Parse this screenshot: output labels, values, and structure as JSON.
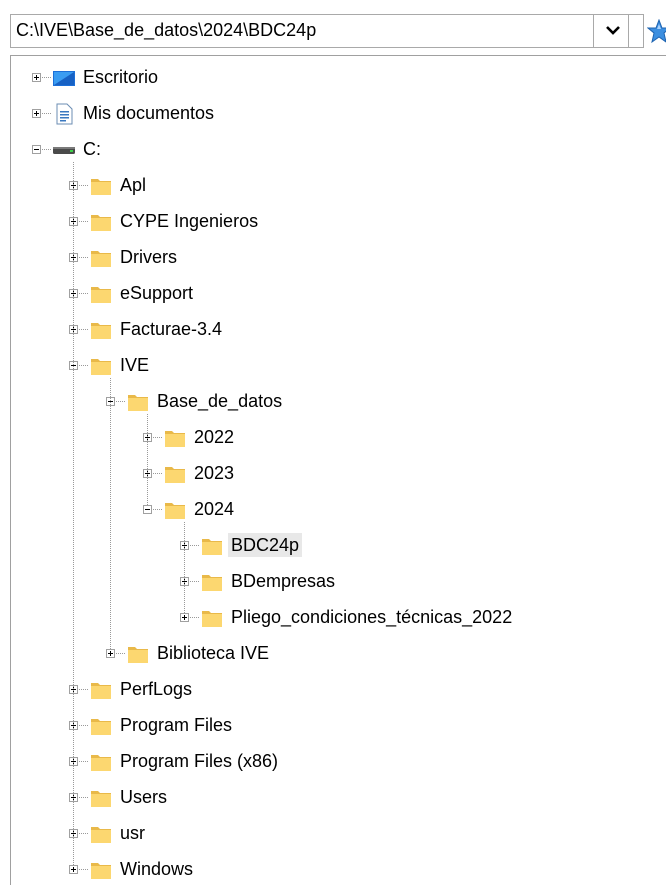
{
  "path": {
    "value": "C:\\IVE\\Base_de_datos\\2024\\BDC24p"
  },
  "icons": {
    "chevron": "chevron-down-icon",
    "favorite": "star-icon",
    "folder": "folder-icon",
    "drive": "drive-icon",
    "desktop": "desktop-icon",
    "documents": "documents-icon"
  },
  "colors": {
    "folder": "#fcd770",
    "folder_dark": "#e9b949",
    "selection": "#e8e8e8"
  },
  "tree": [
    {
      "label": "Escritorio",
      "level": 0,
      "state": "collapsed",
      "icon": "desktop-icon"
    },
    {
      "label": "Mis documentos",
      "level": 0,
      "state": "collapsed",
      "icon": "documents-icon"
    },
    {
      "label": "C:",
      "level": 0,
      "state": "expanded",
      "icon": "drive-icon"
    },
    {
      "label": "Apl",
      "level": 1,
      "state": "collapsed",
      "icon": "folder-icon"
    },
    {
      "label": "CYPE Ingenieros",
      "level": 1,
      "state": "collapsed",
      "icon": "folder-icon"
    },
    {
      "label": "Drivers",
      "level": 1,
      "state": "collapsed",
      "icon": "folder-icon"
    },
    {
      "label": "eSupport",
      "level": 1,
      "state": "collapsed",
      "icon": "folder-icon"
    },
    {
      "label": "Facturae-3.4",
      "level": 1,
      "state": "collapsed",
      "icon": "folder-icon"
    },
    {
      "label": "IVE",
      "level": 1,
      "state": "expanded",
      "icon": "folder-icon"
    },
    {
      "label": "Base_de_datos",
      "level": 2,
      "state": "expanded",
      "icon": "folder-icon"
    },
    {
      "label": "2022",
      "level": 3,
      "state": "collapsed",
      "icon": "folder-icon"
    },
    {
      "label": "2023",
      "level": 3,
      "state": "collapsed",
      "icon": "folder-icon"
    },
    {
      "label": "2024",
      "level": 3,
      "state": "expanded",
      "icon": "folder-icon"
    },
    {
      "label": "BDC24p",
      "level": 4,
      "state": "collapsed",
      "icon": "folder-icon",
      "selected": true
    },
    {
      "label": "BDempresas",
      "level": 4,
      "state": "collapsed",
      "icon": "folder-icon"
    },
    {
      "label": "Pliego_condiciones_técnicas_2022",
      "level": 4,
      "state": "collapsed",
      "icon": "folder-icon"
    },
    {
      "label": "Biblioteca IVE",
      "level": 2,
      "state": "collapsed",
      "icon": "folder-icon"
    },
    {
      "label": "PerfLogs",
      "level": 1,
      "state": "collapsed",
      "icon": "folder-icon"
    },
    {
      "label": "Program Files",
      "level": 1,
      "state": "collapsed",
      "icon": "folder-icon"
    },
    {
      "label": "Program Files (x86)",
      "level": 1,
      "state": "collapsed",
      "icon": "folder-icon"
    },
    {
      "label": "Users",
      "level": 1,
      "state": "collapsed",
      "icon": "folder-icon"
    },
    {
      "label": "usr",
      "level": 1,
      "state": "collapsed",
      "icon": "folder-icon"
    },
    {
      "label": "Windows",
      "level": 1,
      "state": "collapsed",
      "icon": "folder-icon"
    }
  ]
}
